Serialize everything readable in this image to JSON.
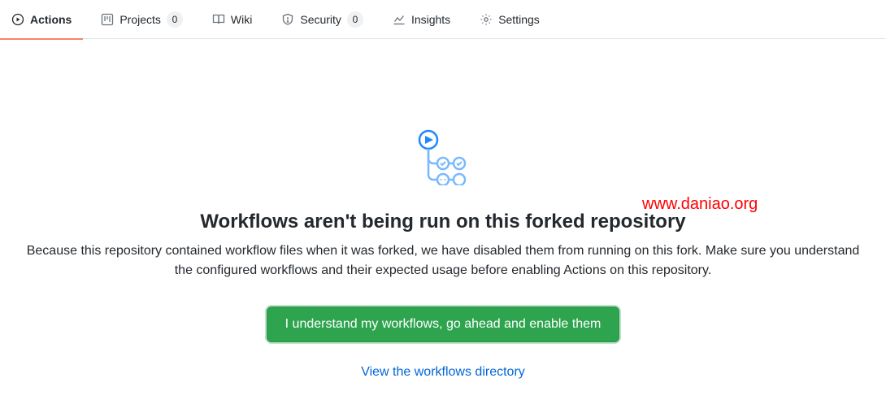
{
  "tabs": {
    "actions": {
      "label": "Actions"
    },
    "projects": {
      "label": "Projects",
      "count": "0"
    },
    "wiki": {
      "label": "Wiki"
    },
    "security": {
      "label": "Security",
      "count": "0"
    },
    "insights": {
      "label": "Insights"
    },
    "settings": {
      "label": "Settings"
    }
  },
  "watermark": "www.daniao.org",
  "main": {
    "heading": "Workflows aren't being run on this forked repository",
    "description": "Because this repository contained workflow files when it was forked, we have disabled them from running on this fork. Make sure you understand the configured workflows and their expected usage before enabling Actions on this repository.",
    "enable_button": "I understand my workflows, go ahead and enable them",
    "view_link": "View the workflows directory"
  }
}
